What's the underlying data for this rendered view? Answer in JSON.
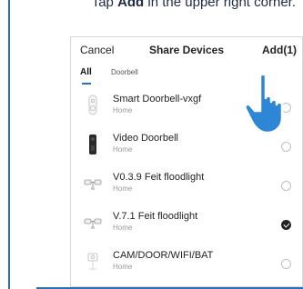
{
  "instruction": {
    "prefix": "Tap ",
    "bold": "Add",
    "suffix": " in the upper right corner."
  },
  "header": {
    "cancel_label": "Cancel",
    "title": "Share Devices",
    "add_label": "Add(1)"
  },
  "tabs": [
    {
      "label": "All",
      "selected": true
    },
    {
      "label": "Doorbell",
      "selected": false
    }
  ],
  "devices": [
    {
      "name": "Smart Doorbell-vxgf",
      "location": "Home",
      "icon": "smart-doorbell-icon",
      "checked": false
    },
    {
      "name": "Video Doorbell",
      "location": "Home",
      "icon": "video-doorbell-icon",
      "checked": false
    },
    {
      "name": "V0.3.9 Feit floodlight",
      "location": "Home",
      "icon": "floodlight-icon",
      "checked": false
    },
    {
      "name": "V.7.1 Feit floodlight",
      "location": "Home",
      "icon": "floodlight-icon",
      "checked": true
    },
    {
      "name": "CAM/DOOR/WIFI/BAT",
      "location": "Home",
      "icon": "camera-icon",
      "checked": false
    }
  ],
  "colors": {
    "accent": "#2f6fb5",
    "hand": "#2e86d6",
    "text": "#222222",
    "subtext": "#999999"
  }
}
